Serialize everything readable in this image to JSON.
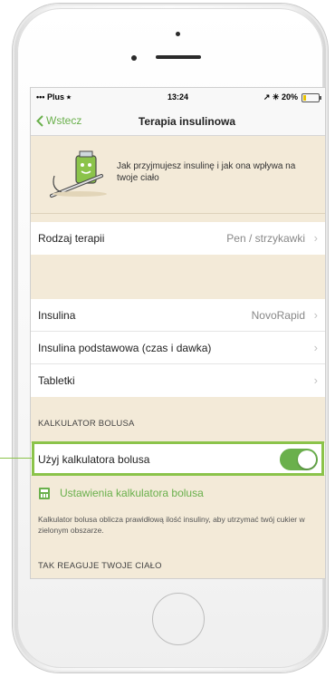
{
  "status_bar": {
    "carrier": "••• Plus ⭑",
    "time": "13:24",
    "right": "↗ ✳ 20%",
    "battery_level": 0.2,
    "battery_color": "#e8c200"
  },
  "nav": {
    "back_label": "Wstecz",
    "title": "Terapia insulinowa",
    "accent_color": "#6ab04c"
  },
  "banner": {
    "text": "Jak przyjmujesz insulinę i jak ona wpływa na twoje ciało",
    "icon": "insulin-pen-illustration"
  },
  "therapy": {
    "label": "Rodzaj terapii",
    "value": "Pen / strzykawki"
  },
  "medications": [
    {
      "label": "Insulina",
      "value": "NovoRapid"
    },
    {
      "label": "Insulina podstawowa (czas i dawka)",
      "value": ""
    },
    {
      "label": "Tabletki",
      "value": ""
    }
  ],
  "bolus_calculator": {
    "section_title": "KALKULATOR BOLUSA",
    "toggle_label": "Użyj kalkulatora bolusa",
    "toggle_on": true,
    "settings_label": "Ustawienia kalkulatora bolusa",
    "settings_icon": "calculator-icon",
    "note": "Kalkulator bolusa oblicza prawidłową ilość insuliny, aby utrzymać twój cukier w zielonym obszarze."
  },
  "body_reaction": {
    "section_title": "TAK REAGUJE TWOJE CIAŁO"
  }
}
